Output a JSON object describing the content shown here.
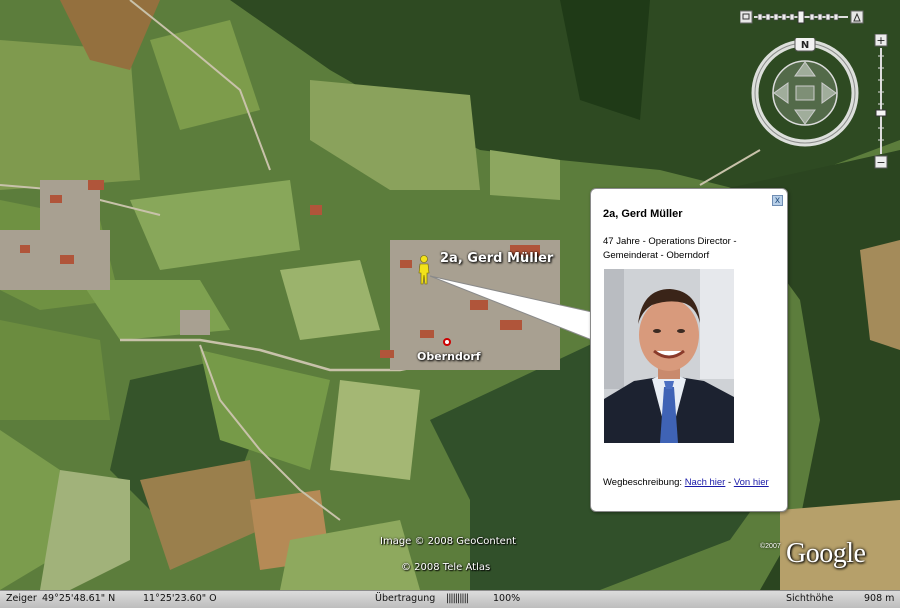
{
  "map": {
    "placemark_user_label": "2a, Gerd Müller",
    "placemark_town_label": "Oberndorf",
    "credits": {
      "image": "Image © 2008 GeoContent",
      "atlas": "© 2008 Tele Atlas",
      "google_logo": "Google",
      "google_copyright": "©2007"
    }
  },
  "navigation": {
    "compass_north": "N",
    "zoom_in": "+",
    "zoom_out": "−",
    "icons": [
      "compass-ring-icon",
      "pan-arrows-icon",
      "tilt-slider-icon",
      "zoom-slider-icon"
    ]
  },
  "balloon": {
    "title": "2a, Gerd Müller",
    "description": "47 Jahre - Operations Director - Gemeinderat - Oberndorf",
    "directions_label": "Wegbeschreibung:",
    "directions_to": "Nach hier",
    "directions_sep": "-",
    "directions_from": "Von hier",
    "close_label": "x"
  },
  "status_bar": {
    "pointer_label": "Zeiger",
    "latitude": "49°25'48.61\" N",
    "longitude": "11°25'23.60\" O",
    "streaming_label": "Übertragung",
    "streaming_bar": "||||||||||",
    "streaming_percent": "100%",
    "eye_alt_label": "Sichthöhe",
    "eye_alt_value": "908 m"
  },
  "colors": {
    "link": "#1a1aa8",
    "balloon_border": "#8a8a8a",
    "forest": "#2f4a22",
    "field": "#6e9447"
  }
}
